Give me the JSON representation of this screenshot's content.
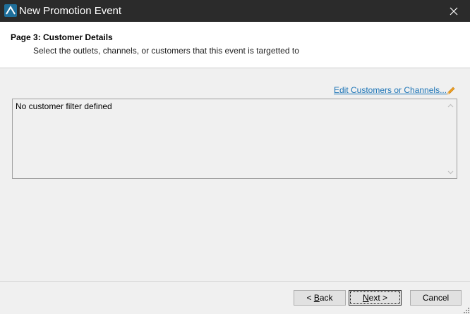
{
  "window": {
    "title": "New Promotion Event"
  },
  "header": {
    "page_title": "Page 3: Customer Details",
    "subtitle": "Select the outlets, channels, or customers that this event is targetted to"
  },
  "main": {
    "edit_link": "Edit Customers or Channels...",
    "filter_text": "No customer filter defined"
  },
  "footer": {
    "back_prefix": "< ",
    "back_underline": "B",
    "back_rest": "ack",
    "next_underline": "N",
    "next_rest": "ext >",
    "cancel_label": "Cancel"
  },
  "colors": {
    "titlebar": "#2b2b2b",
    "link": "#1a73b6",
    "pencil": "#f0a020"
  }
}
